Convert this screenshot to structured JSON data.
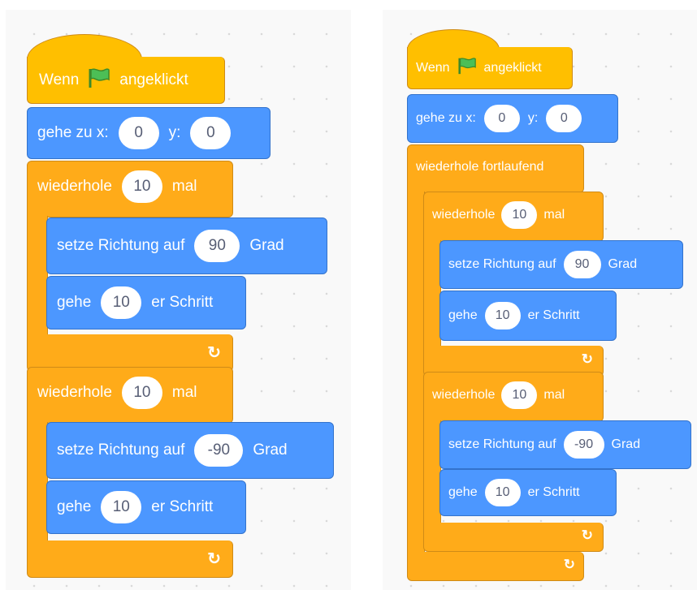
{
  "left": {
    "hat": {
      "pre": "Wenn",
      "post": "angeklickt"
    },
    "goto": {
      "label": "gehe zu x:",
      "x": "0",
      "ylabel": "y:",
      "y": "0"
    },
    "loop1": {
      "label": "wiederhole",
      "count": "10",
      "suffix": "mal",
      "dir": {
        "label": "setze Richtung auf",
        "value": "90",
        "unit": "Grad"
      },
      "move": {
        "label": "gehe",
        "value": "10",
        "suffix": "er Schritt"
      }
    },
    "loop2": {
      "label": "wiederhole",
      "count": "10",
      "suffix": "mal",
      "dir": {
        "label": "setze Richtung auf",
        "value": "-90",
        "unit": "Grad"
      },
      "move": {
        "label": "gehe",
        "value": "10",
        "suffix": "er Schritt"
      }
    }
  },
  "right": {
    "hat": {
      "pre": "Wenn",
      "post": "angeklickt"
    },
    "goto": {
      "label": "gehe zu x:",
      "x": "0",
      "ylabel": "y:",
      "y": "0"
    },
    "forever": {
      "label": "wiederhole fortlaufend"
    },
    "loop1": {
      "label": "wiederhole",
      "count": "10",
      "suffix": "mal",
      "dir": {
        "label": "setze Richtung auf",
        "value": "90",
        "unit": "Grad"
      },
      "move": {
        "label": "gehe",
        "value": "10",
        "suffix": "er Schritt"
      }
    },
    "loop2": {
      "label": "wiederhole",
      "count": "10",
      "suffix": "mal",
      "dir": {
        "label": "setze Richtung auf",
        "value": "-90",
        "unit": "Grad"
      },
      "move": {
        "label": "gehe",
        "value": "10",
        "suffix": "er Schritt"
      }
    }
  },
  "icons": {
    "flag": "green-flag-icon",
    "loop_arrow": "loop-arrow-icon"
  },
  "colors": {
    "events": "#ffbf00",
    "control": "#ffab19",
    "motion": "#4c97ff",
    "background": "#f9f9f9"
  }
}
